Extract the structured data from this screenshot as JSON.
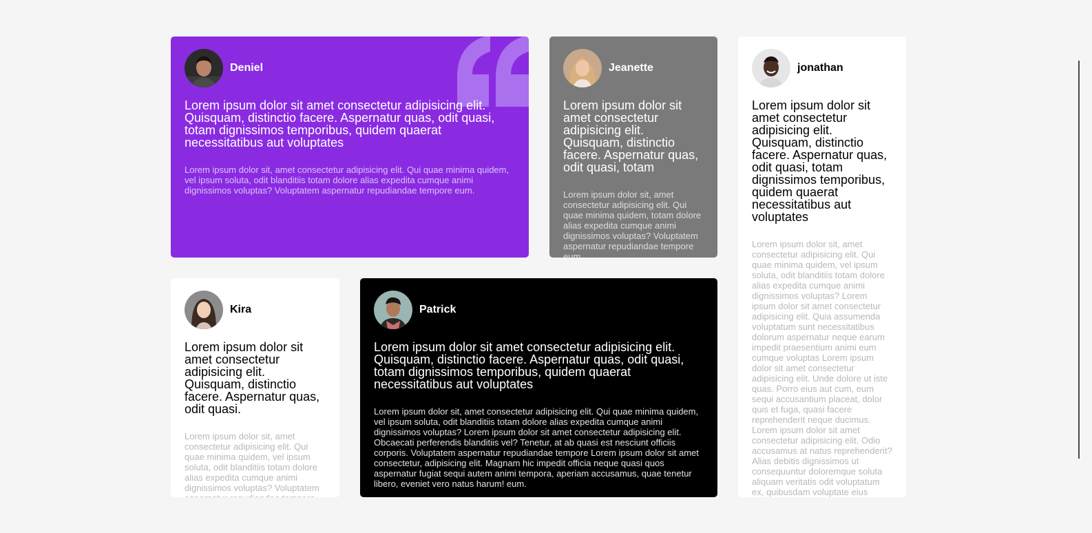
{
  "cards": [
    {
      "name": "Deniel",
      "avatar": "avatar-deniel",
      "quote": "Lorem ipsum dolor sit amet consectetur adipisicing elit. Quisquam, distinctio facere. Aspernatur quas, odit quasi, totam dignissimos temporibus, quidem quaerat necessitatibus aut voluptates",
      "body": "Lorem ipsum dolor sit, amet consectetur adipisicing elit. Qui quae minima quidem, vel ipsum soluta, odit blanditiis totam dolore alias expedita cumque animi dignissimos voluptas? Voluptatem aspernatur repudiandae tempore eum.",
      "bg": "#8a2be2"
    },
    {
      "name": "Jeanette",
      "avatar": "avatar-jeanette",
      "quote": "Lorem ipsum dolor sit amet consectetur adipisicing elit. Quisquam, distinctio facere. Aspernatur quas, odit quasi, totam",
      "body": "Lorem ipsum dolor sit, amet consectetur adipisicing elit. Qui quae minima quidem, totam dolore alias expedita cumque animi dignissimos voluptas? Voluptatem aspernatur repudiandae tempore eum.",
      "bg": "#7a7a7a"
    },
    {
      "name": "jonathan",
      "avatar": "avatar-jonathan",
      "quote": "Lorem ipsum dolor sit amet consectetur adipisicing elit. Quisquam, distinctio facere. Aspernatur quas, odit quasi, totam dignissimos temporibus, quidem quaerat necessitatibus aut voluptates",
      "body": "Lorem ipsum dolor sit, amet consectetur adipisicing elit. Qui quae minima quidem, vel ipsum soluta, odit blanditiis totam dolore alias expedita cumque animi dignissimos voluptas? Lorem ipsum dolor sit amet consectetur adipisicing elit. Quia assumenda voluptatum sunt necessitatibus dolorum aspernatur neque earum impedit praesentium animi eum cumque voluptas Lorem ipsum dolor sit amet consectetur adipisicing elit. Unde dolore ut iste quas. Porro eius aut cum, eum sequi accusantium placeat, dolor quis et fuga, quasi facere reprehenderit neque ducimus. Lorem ipsum dolor sit amet consectetur adipisicing elit. Odio accusamus at natus reprehenderit? Alias debitis dignissimos ut consequuntur doloremque soluta aliquam veritatis odit voluptatum ex, quibusdam voluptate eius aperiam labore hic, modi sit culpa. Voluptatem aspernatur repudiandae tempore eum.",
      "bg": "#ffffff"
    },
    {
      "name": "Kira",
      "avatar": "avatar-kira",
      "quote": "Lorem ipsum dolor sit amet consectetur adipisicing elit. Quisquam, distinctio facere. Aspernatur quas, odit quasi.",
      "body": "Lorem ipsum dolor sit, amet consectetur adipisicing elit. Qui quae minima quidem, vel ipsum soluta, odit blanditiis totam dolore alias expedita cumque animi dignissimos voluptas? Voluptatem aspernatur repudiandae tempore eum.",
      "bg": "#ffffff"
    },
    {
      "name": "Patrick",
      "avatar": "avatar-patrick",
      "quote": "Lorem ipsum dolor sit amet consectetur adipisicing elit. Quisquam, distinctio facere. Aspernatur quas, odit quasi, totam dignissimos temporibus, quidem quaerat necessitatibus aut voluptates",
      "body": "Lorem ipsum dolor sit, amet consectetur adipisicing elit. Qui quae minima quidem, vel ipsum soluta, odit blanditiis totam dolore alias expedita cumque animi dignissimos voluptas? Lorem ipsum dolor sit amet consectetur adipisicing elit. Obcaecati perferendis blanditiis vel? Tenetur, at ab quasi est nesciunt officiis corporis. Voluptatem aspernatur repudiandae tempore Lorem ipsum dolor sit amet consectetur, adipisicing elit. Magnam hic impedit officia neque quasi quos aspernatur fugiat sequi autem animi tempora, aperiam accusamus, quae tenetur libero, eveniet vero natus harum! eum.",
      "bg": "#000000"
    }
  ],
  "decor": {
    "quote_icon": "quote-mark-icon",
    "quote_color": "#b07cf0"
  }
}
